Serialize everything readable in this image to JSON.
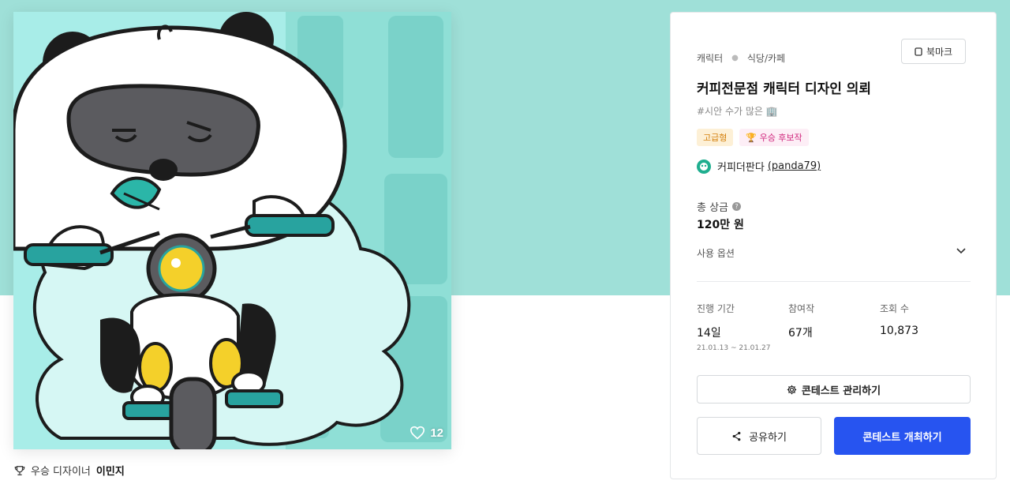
{
  "artwork": {
    "like_count": "12",
    "like_icon": "heart-icon"
  },
  "winner_caption": {
    "icon": "trophy-icon",
    "label": "우승 디자이너",
    "name": "이민지"
  },
  "contest": {
    "category": "캐릭터",
    "subcategory": "식당/카페",
    "bookmark_label": "북마크",
    "title": "커피전문점 캐릭터 디자인 의뢰",
    "hashtag": "#시안 수가 많은 🏢",
    "badges": [
      {
        "label": "고급형"
      },
      {
        "label": "🏆 우승 후보작"
      }
    ],
    "host_name": "커피더판다",
    "host_id": "(panda79)"
  },
  "prize": {
    "label": "총 상금",
    "value": "120만 원"
  },
  "usage_label": "사용 옵션",
  "stats": [
    {
      "label": "진행 기간",
      "value": "14일",
      "detail": "21.01.13 ~ 21.01.27"
    },
    {
      "label": "참여작",
      "value": "67개",
      "detail": ""
    },
    {
      "label": "조회 수",
      "value": "10,873",
      "detail": ""
    }
  ],
  "buttons": {
    "manage": "콘테스트 관리하기",
    "share": "공유하기",
    "host": "콘테스트 개최하기"
  },
  "colors": {
    "header_band": "#9fe0d8",
    "primary": "#2754f0",
    "premium_badge": "#d4800c",
    "candidate_badge": "#d0277d"
  }
}
